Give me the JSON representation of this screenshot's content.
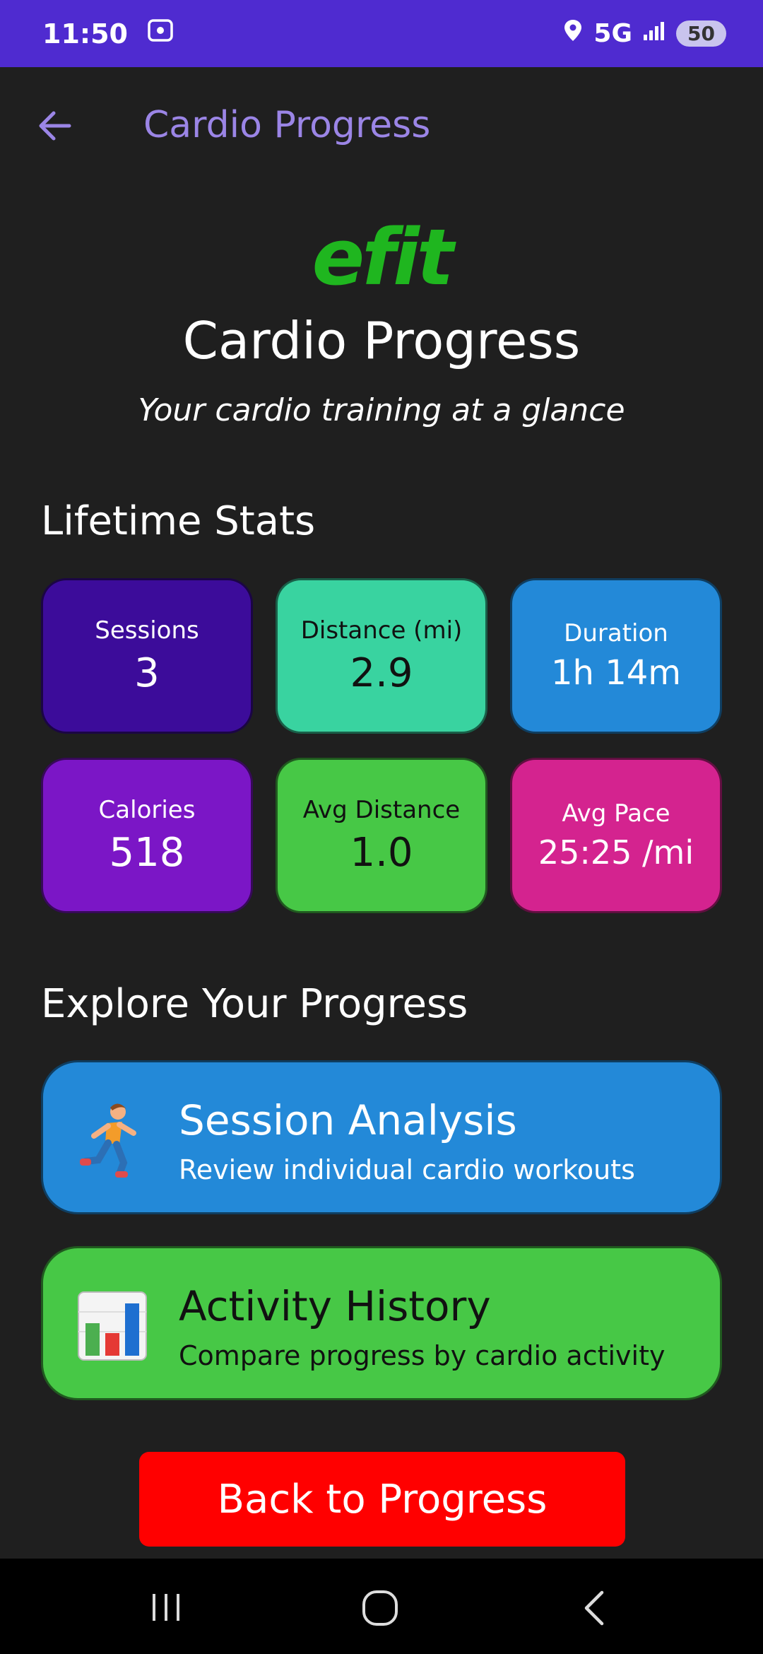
{
  "status_bar": {
    "time": "11:50",
    "network": "5G",
    "battery": "50"
  },
  "app_bar": {
    "title": "Cardio Progress"
  },
  "header": {
    "logo_text": "efit",
    "title": "Cardio Progress",
    "subtitle": "Your cardio training at a glance"
  },
  "lifetime": {
    "heading": "Lifetime Stats",
    "stats": [
      {
        "label": "Sessions",
        "value": "3",
        "color": "#3c0c9a"
      },
      {
        "label": "Distance (mi)",
        "value": "2.9",
        "color": "#39d3a0"
      },
      {
        "label": "Duration",
        "value": "1h 14m",
        "color": "#2389d8"
      },
      {
        "label": "Calories",
        "value": "518",
        "color": "#7b16c6"
      },
      {
        "label": "Avg Distance",
        "value": "1.0",
        "color": "#47c846"
      },
      {
        "label": "Avg Pace",
        "value": "25:25 /mi",
        "color": "#d4238f"
      }
    ]
  },
  "explore": {
    "heading": "Explore Your Progress",
    "items": [
      {
        "title": "Session Analysis",
        "subtitle": "Review individual cardio workouts",
        "icon": "runner-icon",
        "color": "#2389d8"
      },
      {
        "title": "Activity History",
        "subtitle": "Compare progress by cardio activity",
        "icon": "bar-chart-icon",
        "color": "#47c846"
      }
    ]
  },
  "back_button": {
    "label": "Back to Progress",
    "color": "#ff0000"
  }
}
